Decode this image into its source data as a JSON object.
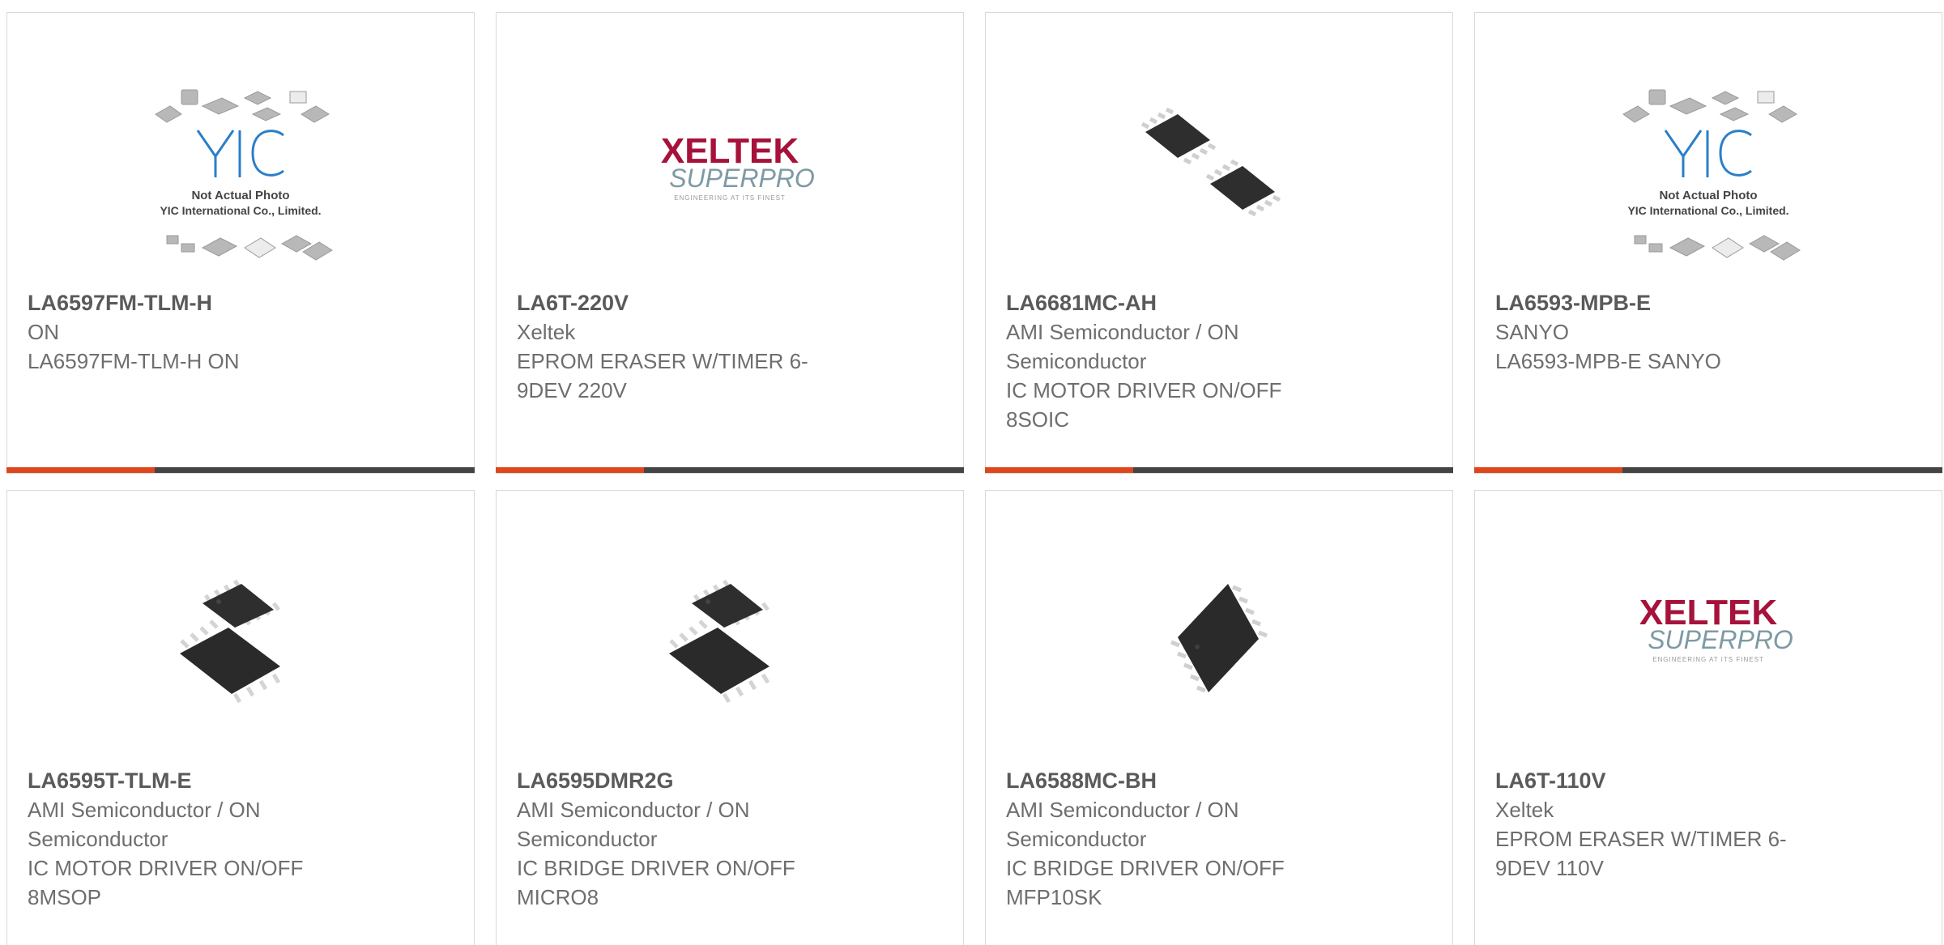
{
  "colors": {
    "accent": "#e0461c",
    "bar_dark": "#444444",
    "text": "#6e6e6e"
  },
  "yic_logo": {
    "line1": "Not Actual Photo",
    "line2": "YIC International Co., Limited."
  },
  "xeltek_logo": {
    "brand": "XELTEK",
    "sub": "SUPERPRO",
    "tagline": "ENGINEERING AT ITS FINEST"
  },
  "products": [
    {
      "part": "LA6597FM-TLM-H",
      "maker": "ON",
      "desc": "LA6597FM-TLM-H ON",
      "image": "yic-placeholder"
    },
    {
      "part": "LA6T-220V",
      "maker": "Xeltek",
      "desc": "EPROM ERASER W/TIMER 6-9DEV 220V",
      "image": "xeltek-logo"
    },
    {
      "part": "LA6681MC-AH",
      "maker": "AMI Semiconductor / ON Semiconductor",
      "desc": "IC MOTOR DRIVER ON/OFF 8SOIC",
      "image": "soic8-chips"
    },
    {
      "part": "LA6593-MPB-E",
      "maker": "SANYO",
      "desc": "LA6593-MPB-E SANYO",
      "image": "yic-placeholder"
    },
    {
      "part": "LA6595T-TLM-E",
      "maker": "AMI Semiconductor / ON Semiconductor",
      "desc": "IC MOTOR DRIVER ON/OFF 8MSOP",
      "image": "msop8-chips"
    },
    {
      "part": "LA6595DMR2G",
      "maker": "AMI Semiconductor / ON Semiconductor",
      "desc": "IC BRIDGE DRIVER ON/OFF MICRO8",
      "image": "msop8-chips"
    },
    {
      "part": "LA6588MC-BH",
      "maker": "AMI Semiconductor / ON Semiconductor",
      "desc": "IC BRIDGE DRIVER ON/OFF MFP10SK",
      "image": "mfp10-chip"
    },
    {
      "part": "LA6T-110V",
      "maker": "Xeltek",
      "desc": "EPROM ERASER W/TIMER 6-9DEV 110V",
      "image": "xeltek-logo"
    }
  ]
}
